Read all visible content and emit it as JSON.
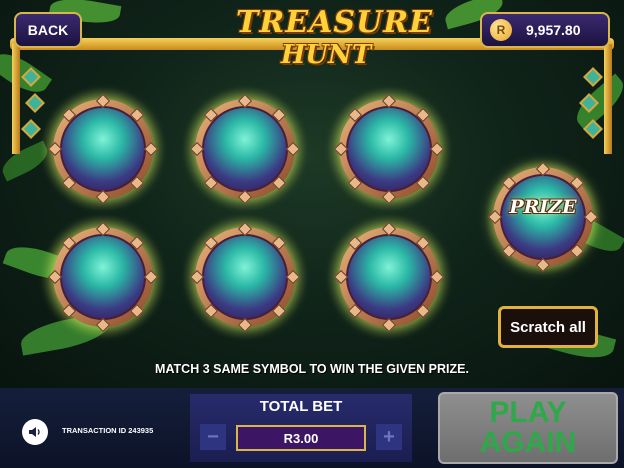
{
  "header": {
    "back_label": "BACK",
    "balance_currency_symbol": "R",
    "balance_value": "9,957.80",
    "logo_line1": "TREASURE",
    "logo_line2": "HUNT"
  },
  "board": {
    "scratch_spots": [
      {
        "icon": "teal-orb"
      },
      {
        "icon": "teal-orb"
      },
      {
        "icon": "teal-orb"
      },
      {
        "icon": "teal-orb"
      },
      {
        "icon": "teal-orb"
      },
      {
        "icon": "teal-orb"
      }
    ],
    "prize_label": "PRIZE",
    "scratch_all_label": "Scratch all",
    "instruction": "MATCH 3 SAME SYMBOL TO WIN THE GIVEN PRIZE."
  },
  "footer": {
    "sound_icon": "speaker-icon",
    "transaction_label": "TRANSACTION ID 243935",
    "total_bet_label": "TOTAL BET",
    "bet_minus_label": "−",
    "bet_value": "R3.00",
    "bet_plus_label": "+",
    "play_again_line1": "PLAY",
    "play_again_line2": "AGAIN"
  },
  "colors": {
    "accent_gold": "#d9b64c",
    "panel_purple": "#272b6c",
    "play_disabled": "#7a7a7a",
    "play_text": "#2fa84a"
  }
}
